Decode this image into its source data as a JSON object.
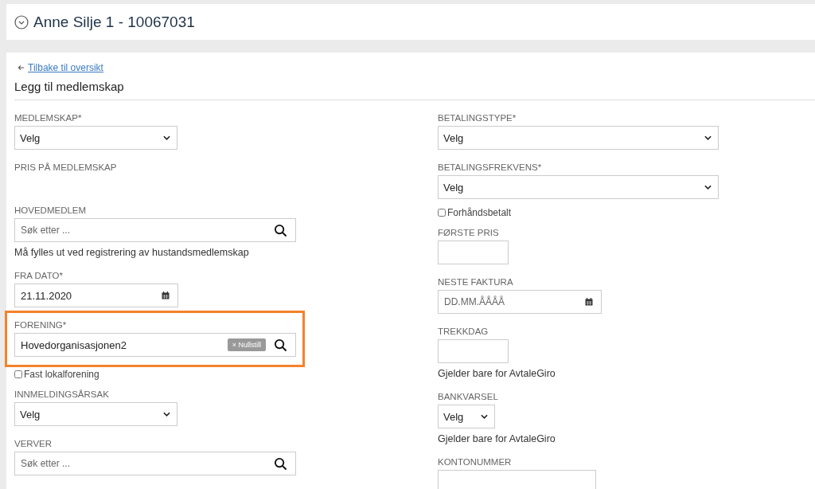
{
  "header": {
    "title": "Anne Silje 1 - 10067031"
  },
  "back_link": {
    "label": "Tilbake til oversikt"
  },
  "form_title": "Legg til medlemskap",
  "left_fields": [
    {
      "kind": "select",
      "label": "MEDLEMSKAP*",
      "value": "Velg"
    },
    {
      "kind": "static",
      "label": "PRIS PÅ MEDLEMSKAP"
    },
    {
      "kind": "search",
      "label": "HOVEDMEDLEM",
      "placeholder": "Søk etter ...",
      "hint": "Må fylles ut ved registrering av hustandsmedlemskap",
      "highlighted": false
    },
    {
      "kind": "date",
      "label": "FRA DATO*",
      "value": "21.11.2020"
    },
    {
      "kind": "search",
      "label": "FORENING*",
      "value": "Hovedorganisasjonen2",
      "clear_label": "× Nullstill",
      "highlighted": true
    },
    {
      "kind": "checkbox",
      "label": "Fast lokalforening",
      "checked": false
    },
    {
      "kind": "select",
      "label": "INNMELDINGSÅRSAK",
      "value": "Velg"
    },
    {
      "kind": "search",
      "label": "VERVER",
      "placeholder": "Søk etter ...",
      "highlighted": false
    }
  ],
  "right_fields": [
    {
      "kind": "select",
      "label": "BETALINGSTYPE*",
      "value": "Velg"
    },
    {
      "kind": "select",
      "label": "BETALINGSFREKVENS*",
      "value": "Velg"
    },
    {
      "kind": "checkbox",
      "label": "Forhåndsbetalt",
      "checked": false
    },
    {
      "kind": "text",
      "label": "FØRSTE PRIS"
    },
    {
      "kind": "date",
      "label": "NESTE FAKTURA",
      "placeholder": "DD.MM.ÅÅÅÅ"
    },
    {
      "kind": "text",
      "label": "TREKKDAG",
      "hint": "Gjelder bare for AvtaleGiro"
    },
    {
      "kind": "select",
      "label": "BANKVARSEL",
      "value": "Velg",
      "hint": "Gjelder bare for AvtaleGiro"
    },
    {
      "kind": "text",
      "label": "KONTONUMMER"
    }
  ]
}
